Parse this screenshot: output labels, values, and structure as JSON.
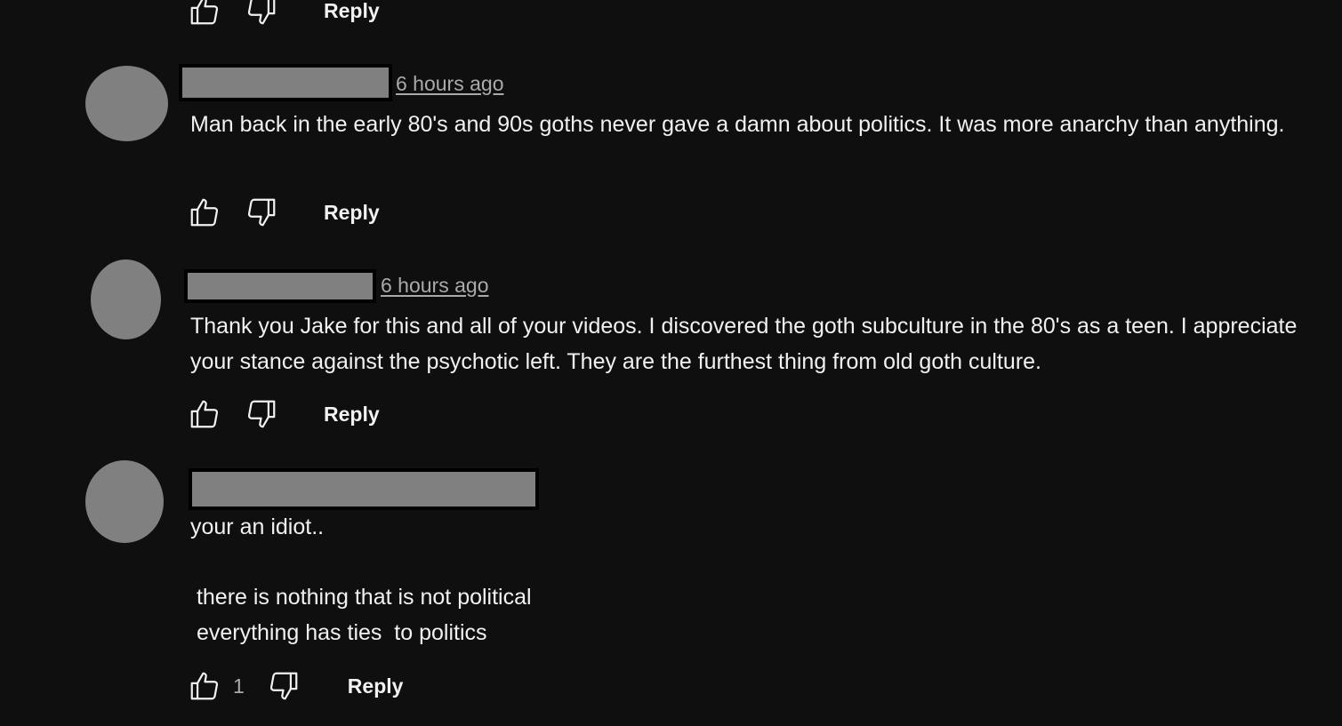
{
  "comments": [
    {
      "time": "",
      "text": "",
      "like_count": "",
      "reply_label": "Reply"
    },
    {
      "time": "6 hours ago",
      "text": "Man back in the early 80's and 90s goths never gave a damn about politics. It was more anarchy than anything.",
      "like_count": "",
      "reply_label": "Reply"
    },
    {
      "time": "6 hours ago",
      "text": "Thank you Jake for this and all of your videos. I discovered the goth subculture in the 80's as a teen. I appreciate your stance against the psychotic left. They are the furthest thing from old goth culture.",
      "like_count": "",
      "reply_label": "Reply"
    },
    {
      "time": "",
      "text": "your an idiot..\n\n there is nothing that is not political\n everything has ties  to politics",
      "like_count": "1",
      "reply_label": "Reply"
    }
  ],
  "icons": {
    "like": "thumb-up-icon",
    "dislike": "thumb-down-icon"
  },
  "colors": {
    "background": "#0f0f0f",
    "text": "#f1f1f1",
    "secondary_text": "#aaaaaa",
    "redaction": "#808080"
  }
}
